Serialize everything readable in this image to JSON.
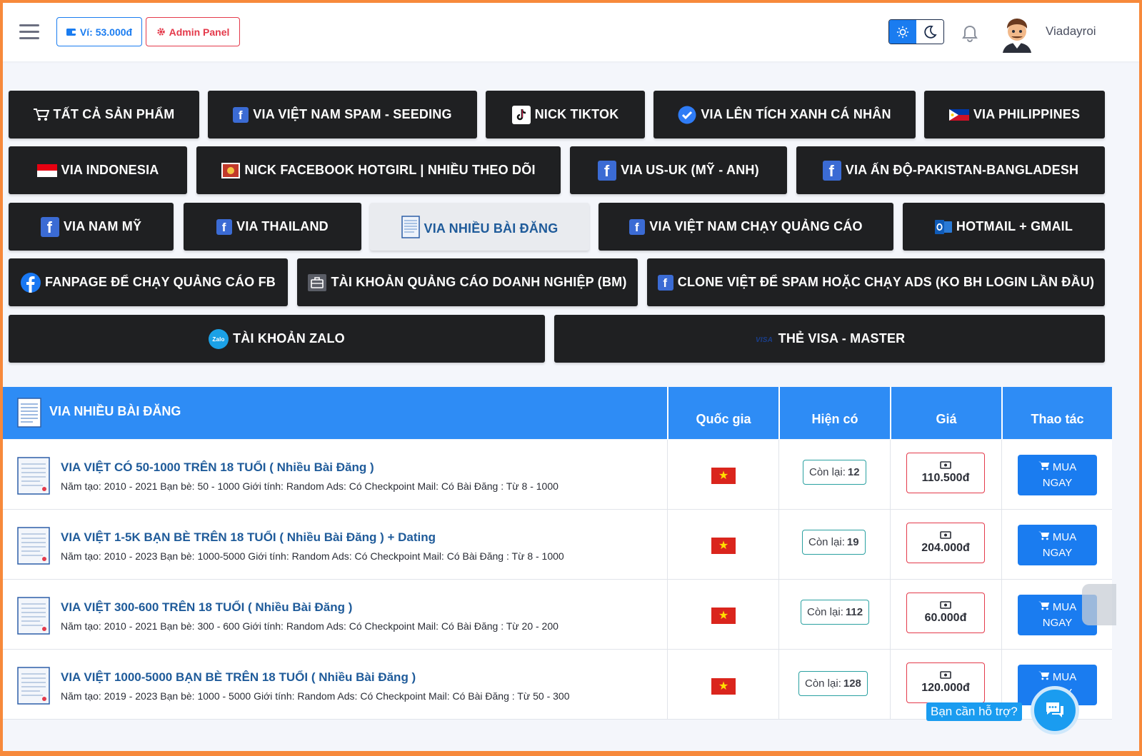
{
  "header": {
    "wallet_label": "Ví: 53.000đ",
    "admin_label": "Admin Panel",
    "username": "Viadayroi"
  },
  "categories": [
    {
      "label": "TẤT CẢ SẢN PHẨM",
      "icon": "cart-icon"
    },
    {
      "label": "VIA VIỆT NAM SPAM - SEEDING",
      "icon": "facebook-icon"
    },
    {
      "label": "NICK TIKTOK",
      "icon": "tiktok-icon"
    },
    {
      "label": "VIA LÊN TÍCH XANH CÁ NHÂN",
      "icon": "verified-badge-icon"
    },
    {
      "label": "VIA PHILIPPINES",
      "icon": "philippines-flag-icon"
    },
    {
      "label": "VIA INDONESIA",
      "icon": "indonesia-flag-icon"
    },
    {
      "label": "NICK FACEBOOK HOTGIRL | NHIỀU THEO DÕI",
      "icon": "hotgirl-icon"
    },
    {
      "label": "VIA US-UK (MỸ - ANH)",
      "icon": "facebook-icon"
    },
    {
      "label": "VIA ẤN ĐỘ-PAKISTAN-BANGLADESH",
      "icon": "facebook-icon"
    },
    {
      "label": "VIA NAM MỸ",
      "icon": "facebook-icon"
    },
    {
      "label": "VIA THAILAND",
      "icon": "facebook-icon"
    },
    {
      "label": "VIA NHIỀU BÀI ĐĂNG",
      "icon": "document-icon"
    },
    {
      "label": "VIA VIỆT NAM CHẠY QUẢNG CÁO",
      "icon": "facebook-icon"
    },
    {
      "label": "HOTMAIL + GMAIL",
      "icon": "outlook-icon"
    },
    {
      "label": "FANPAGE ĐỂ CHẠY QUẢNG CÁO FB",
      "icon": "facebook-round-icon"
    },
    {
      "label": "TÀI KHOẢN QUẢNG CÁO DOANH NGHIỆP (BM)",
      "icon": "briefcase-icon"
    },
    {
      "label": "CLONE VIỆT ĐỂ SPAM HOẶC CHẠY ADS (KO BH LOGIN LẦN ĐẦU)",
      "icon": "facebook-icon"
    },
    {
      "label": "TÀI KHOẢN ZALO",
      "icon": "zalo-icon"
    },
    {
      "label": "THẺ VISA - MASTER",
      "icon": "visa-icon"
    }
  ],
  "table": {
    "title": "VIA NHIỀU BÀI ĐĂNG",
    "columns": [
      "Quốc gia",
      "Hiện có",
      "Giá",
      "Thao tác"
    ],
    "stock_prefix": "Còn lại:",
    "buy_label_1": "MUA",
    "buy_label_2": "NGAY",
    "rows": [
      {
        "name": "VIA VIỆT CÓ 50-1000 TRÊN 18 TUỔI ( Nhiều Bài Đăng )",
        "desc": "Năm tạo: 2010 - 2021 Bạn bè: 50 - 1000 Giới tính: Random Ads: Có Checkpoint Mail: Có Bài Đăng : Từ 8 - 1000",
        "stock": "12",
        "price": "110.500đ"
      },
      {
        "name": "VIA VIỆT 1-5K BẠN BÈ TRÊN 18 TUỔI ( Nhiều Bài Đăng ) + Dating",
        "desc": "Năm tạo: 2010 - 2023 Bạn bè: 1000-5000 Giới tính: Random Ads: Có Checkpoint Mail: Có Bài Đăng : Từ 8 - 1000",
        "stock": "19",
        "price": "204.000đ"
      },
      {
        "name": "VIA VIỆT 300-600 TRÊN 18 TUỔI ( Nhiều Bài Đăng )",
        "desc": "Năm tạo: 2010 - 2021 Bạn bè: 300 - 600 Giới tính: Random Ads: Có Checkpoint Mail: Có Bài Đăng : Từ 20 - 200",
        "stock": "112",
        "price": "60.000đ"
      },
      {
        "name": "VIA VIỆT 1000-5000 BẠN BÈ TRÊN 18 TUỔI ( Nhiều Bài Đăng )",
        "desc": "Năm tạo: 2019 - 2023 Bạn bè: 1000 - 5000 Giới tính: Random Ads: Có Checkpoint Mail: Có Bài Đăng : Từ 50 - 300",
        "stock": "128",
        "price": "120.000đ"
      }
    ]
  },
  "support": {
    "label": "Bạn cần hỗ trợ?"
  },
  "colors": {
    "accent": "#2e8cf5",
    "button_dark": "#1f2022",
    "danger": "#e43a4b",
    "frame": "#f7893b"
  }
}
